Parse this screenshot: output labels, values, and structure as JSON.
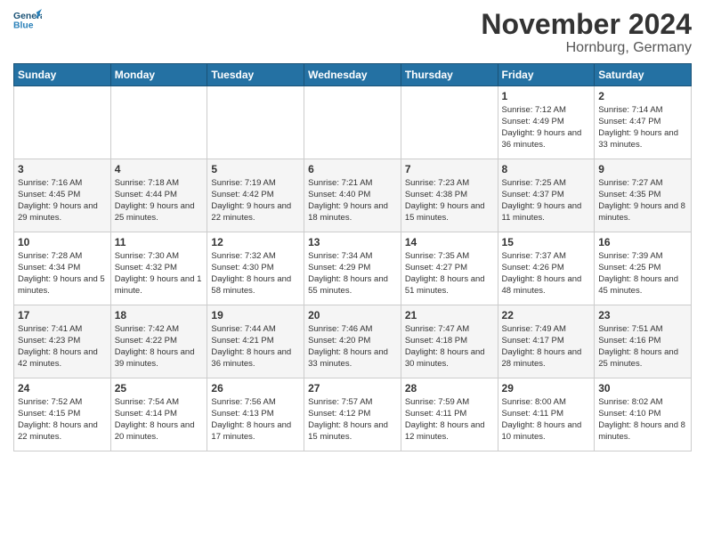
{
  "header": {
    "logo_text_general": "General",
    "logo_text_blue": "Blue",
    "title": "November 2024",
    "subtitle": "Hornburg, Germany"
  },
  "days_of_week": [
    "Sunday",
    "Monday",
    "Tuesday",
    "Wednesday",
    "Thursday",
    "Friday",
    "Saturday"
  ],
  "weeks": [
    [
      {
        "day": "",
        "info": ""
      },
      {
        "day": "",
        "info": ""
      },
      {
        "day": "",
        "info": ""
      },
      {
        "day": "",
        "info": ""
      },
      {
        "day": "",
        "info": ""
      },
      {
        "day": "1",
        "info": "Sunrise: 7:12 AM\nSunset: 4:49 PM\nDaylight: 9 hours and 36 minutes."
      },
      {
        "day": "2",
        "info": "Sunrise: 7:14 AM\nSunset: 4:47 PM\nDaylight: 9 hours and 33 minutes."
      }
    ],
    [
      {
        "day": "3",
        "info": "Sunrise: 7:16 AM\nSunset: 4:45 PM\nDaylight: 9 hours and 29 minutes."
      },
      {
        "day": "4",
        "info": "Sunrise: 7:18 AM\nSunset: 4:44 PM\nDaylight: 9 hours and 25 minutes."
      },
      {
        "day": "5",
        "info": "Sunrise: 7:19 AM\nSunset: 4:42 PM\nDaylight: 9 hours and 22 minutes."
      },
      {
        "day": "6",
        "info": "Sunrise: 7:21 AM\nSunset: 4:40 PM\nDaylight: 9 hours and 18 minutes."
      },
      {
        "day": "7",
        "info": "Sunrise: 7:23 AM\nSunset: 4:38 PM\nDaylight: 9 hours and 15 minutes."
      },
      {
        "day": "8",
        "info": "Sunrise: 7:25 AM\nSunset: 4:37 PM\nDaylight: 9 hours and 11 minutes."
      },
      {
        "day": "9",
        "info": "Sunrise: 7:27 AM\nSunset: 4:35 PM\nDaylight: 9 hours and 8 minutes."
      }
    ],
    [
      {
        "day": "10",
        "info": "Sunrise: 7:28 AM\nSunset: 4:34 PM\nDaylight: 9 hours and 5 minutes."
      },
      {
        "day": "11",
        "info": "Sunrise: 7:30 AM\nSunset: 4:32 PM\nDaylight: 9 hours and 1 minute."
      },
      {
        "day": "12",
        "info": "Sunrise: 7:32 AM\nSunset: 4:30 PM\nDaylight: 8 hours and 58 minutes."
      },
      {
        "day": "13",
        "info": "Sunrise: 7:34 AM\nSunset: 4:29 PM\nDaylight: 8 hours and 55 minutes."
      },
      {
        "day": "14",
        "info": "Sunrise: 7:35 AM\nSunset: 4:27 PM\nDaylight: 8 hours and 51 minutes."
      },
      {
        "day": "15",
        "info": "Sunrise: 7:37 AM\nSunset: 4:26 PM\nDaylight: 8 hours and 48 minutes."
      },
      {
        "day": "16",
        "info": "Sunrise: 7:39 AM\nSunset: 4:25 PM\nDaylight: 8 hours and 45 minutes."
      }
    ],
    [
      {
        "day": "17",
        "info": "Sunrise: 7:41 AM\nSunset: 4:23 PM\nDaylight: 8 hours and 42 minutes."
      },
      {
        "day": "18",
        "info": "Sunrise: 7:42 AM\nSunset: 4:22 PM\nDaylight: 8 hours and 39 minutes."
      },
      {
        "day": "19",
        "info": "Sunrise: 7:44 AM\nSunset: 4:21 PM\nDaylight: 8 hours and 36 minutes."
      },
      {
        "day": "20",
        "info": "Sunrise: 7:46 AM\nSunset: 4:20 PM\nDaylight: 8 hours and 33 minutes."
      },
      {
        "day": "21",
        "info": "Sunrise: 7:47 AM\nSunset: 4:18 PM\nDaylight: 8 hours and 30 minutes."
      },
      {
        "day": "22",
        "info": "Sunrise: 7:49 AM\nSunset: 4:17 PM\nDaylight: 8 hours and 28 minutes."
      },
      {
        "day": "23",
        "info": "Sunrise: 7:51 AM\nSunset: 4:16 PM\nDaylight: 8 hours and 25 minutes."
      }
    ],
    [
      {
        "day": "24",
        "info": "Sunrise: 7:52 AM\nSunset: 4:15 PM\nDaylight: 8 hours and 22 minutes."
      },
      {
        "day": "25",
        "info": "Sunrise: 7:54 AM\nSunset: 4:14 PM\nDaylight: 8 hours and 20 minutes."
      },
      {
        "day": "26",
        "info": "Sunrise: 7:56 AM\nSunset: 4:13 PM\nDaylight: 8 hours and 17 minutes."
      },
      {
        "day": "27",
        "info": "Sunrise: 7:57 AM\nSunset: 4:12 PM\nDaylight: 8 hours and 15 minutes."
      },
      {
        "day": "28",
        "info": "Sunrise: 7:59 AM\nSunset: 4:11 PM\nDaylight: 8 hours and 12 minutes."
      },
      {
        "day": "29",
        "info": "Sunrise: 8:00 AM\nSunset: 4:11 PM\nDaylight: 8 hours and 10 minutes."
      },
      {
        "day": "30",
        "info": "Sunrise: 8:02 AM\nSunset: 4:10 PM\nDaylight: 8 hours and 8 minutes."
      }
    ]
  ]
}
